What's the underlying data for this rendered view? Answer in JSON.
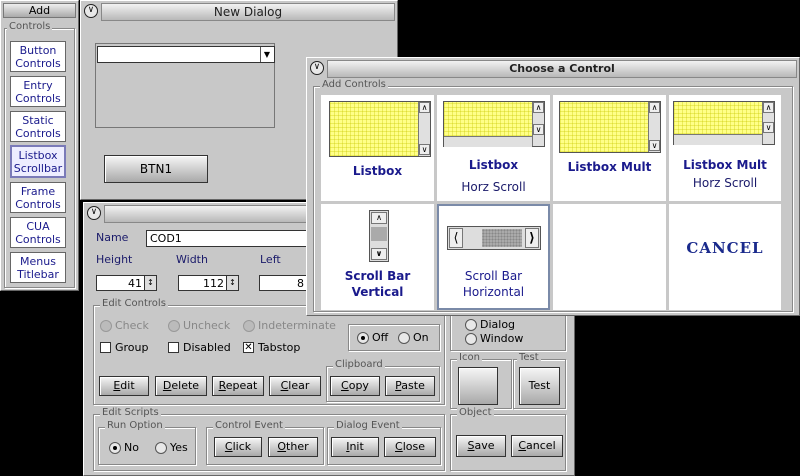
{
  "toolbox": {
    "title": "Add",
    "group_label": "Controls",
    "items": [
      {
        "label": "Button\nControls",
        "active": false
      },
      {
        "label": "Entry\nControls",
        "active": false
      },
      {
        "label": "Static\nControls",
        "active": false
      },
      {
        "label": "Listbox\nScrollbar",
        "active": true
      },
      {
        "label": "Frame\nControls",
        "active": false
      },
      {
        "label": "CUA\nControls",
        "active": false
      },
      {
        "label": "Menus\nTitlebar",
        "active": false
      }
    ]
  },
  "new_dialog": {
    "title": "New Dialog",
    "combo_value": "",
    "button_label": "BTN1"
  },
  "editor": {
    "name_label": "Name",
    "name_value": "COD1",
    "height_label": "Height",
    "height_value": "41",
    "width_label": "Width",
    "width_value": "112",
    "left_label": "Left",
    "left_value": "8",
    "edit_controls": {
      "label": "Edit Controls",
      "check": "Check",
      "uncheck": "Uncheck",
      "indeterminate": "Indeterminate",
      "group": "Group",
      "disabled": "Disabled",
      "tabstop": "Tabstop",
      "off": "Off",
      "on": "On",
      "edit": "Edit",
      "delete": "Delete",
      "repeat": "Repeat",
      "clear": "Clear"
    },
    "clipboard": {
      "label": "Clipboard",
      "copy": "Copy",
      "paste": "Paste"
    },
    "dialog_opt": "Dialog",
    "window_opt": "Window",
    "icon_label": "Icon",
    "test": {
      "label": "Test",
      "button": "Test"
    },
    "edit_scripts": {
      "label": "Edit Scripts",
      "run_option": "Run Option",
      "no": "No",
      "yes": "Yes",
      "control_event": "Control Event",
      "click": "Click",
      "other": "Other",
      "dialog_event": "Dialog Event",
      "init": "Init",
      "close": "Close"
    },
    "object": {
      "label": "Object",
      "save": "Save",
      "cancel": "Cancel"
    }
  },
  "chooser": {
    "title": "Choose a Control",
    "group_label": "Add Controls",
    "cells": [
      {
        "l1": "Listbox",
        "l2": ""
      },
      {
        "l1": "Listbox",
        "l2": "Horz Scroll"
      },
      {
        "l1": "Listbox Mult",
        "l2": ""
      },
      {
        "l1": "Listbox Mult",
        "l2": "Horz Scroll"
      },
      {
        "l1": "Scroll Bar",
        "l2": "Vertical"
      },
      {
        "l1": "Scroll Bar",
        "l2": "Horizontal"
      },
      {
        "l1": "",
        "l2": ""
      },
      {
        "l1": "CANCEL",
        "l2": ""
      }
    ]
  },
  "colors": {
    "accent": "#1a1a8c",
    "preview": "#ffff88"
  }
}
